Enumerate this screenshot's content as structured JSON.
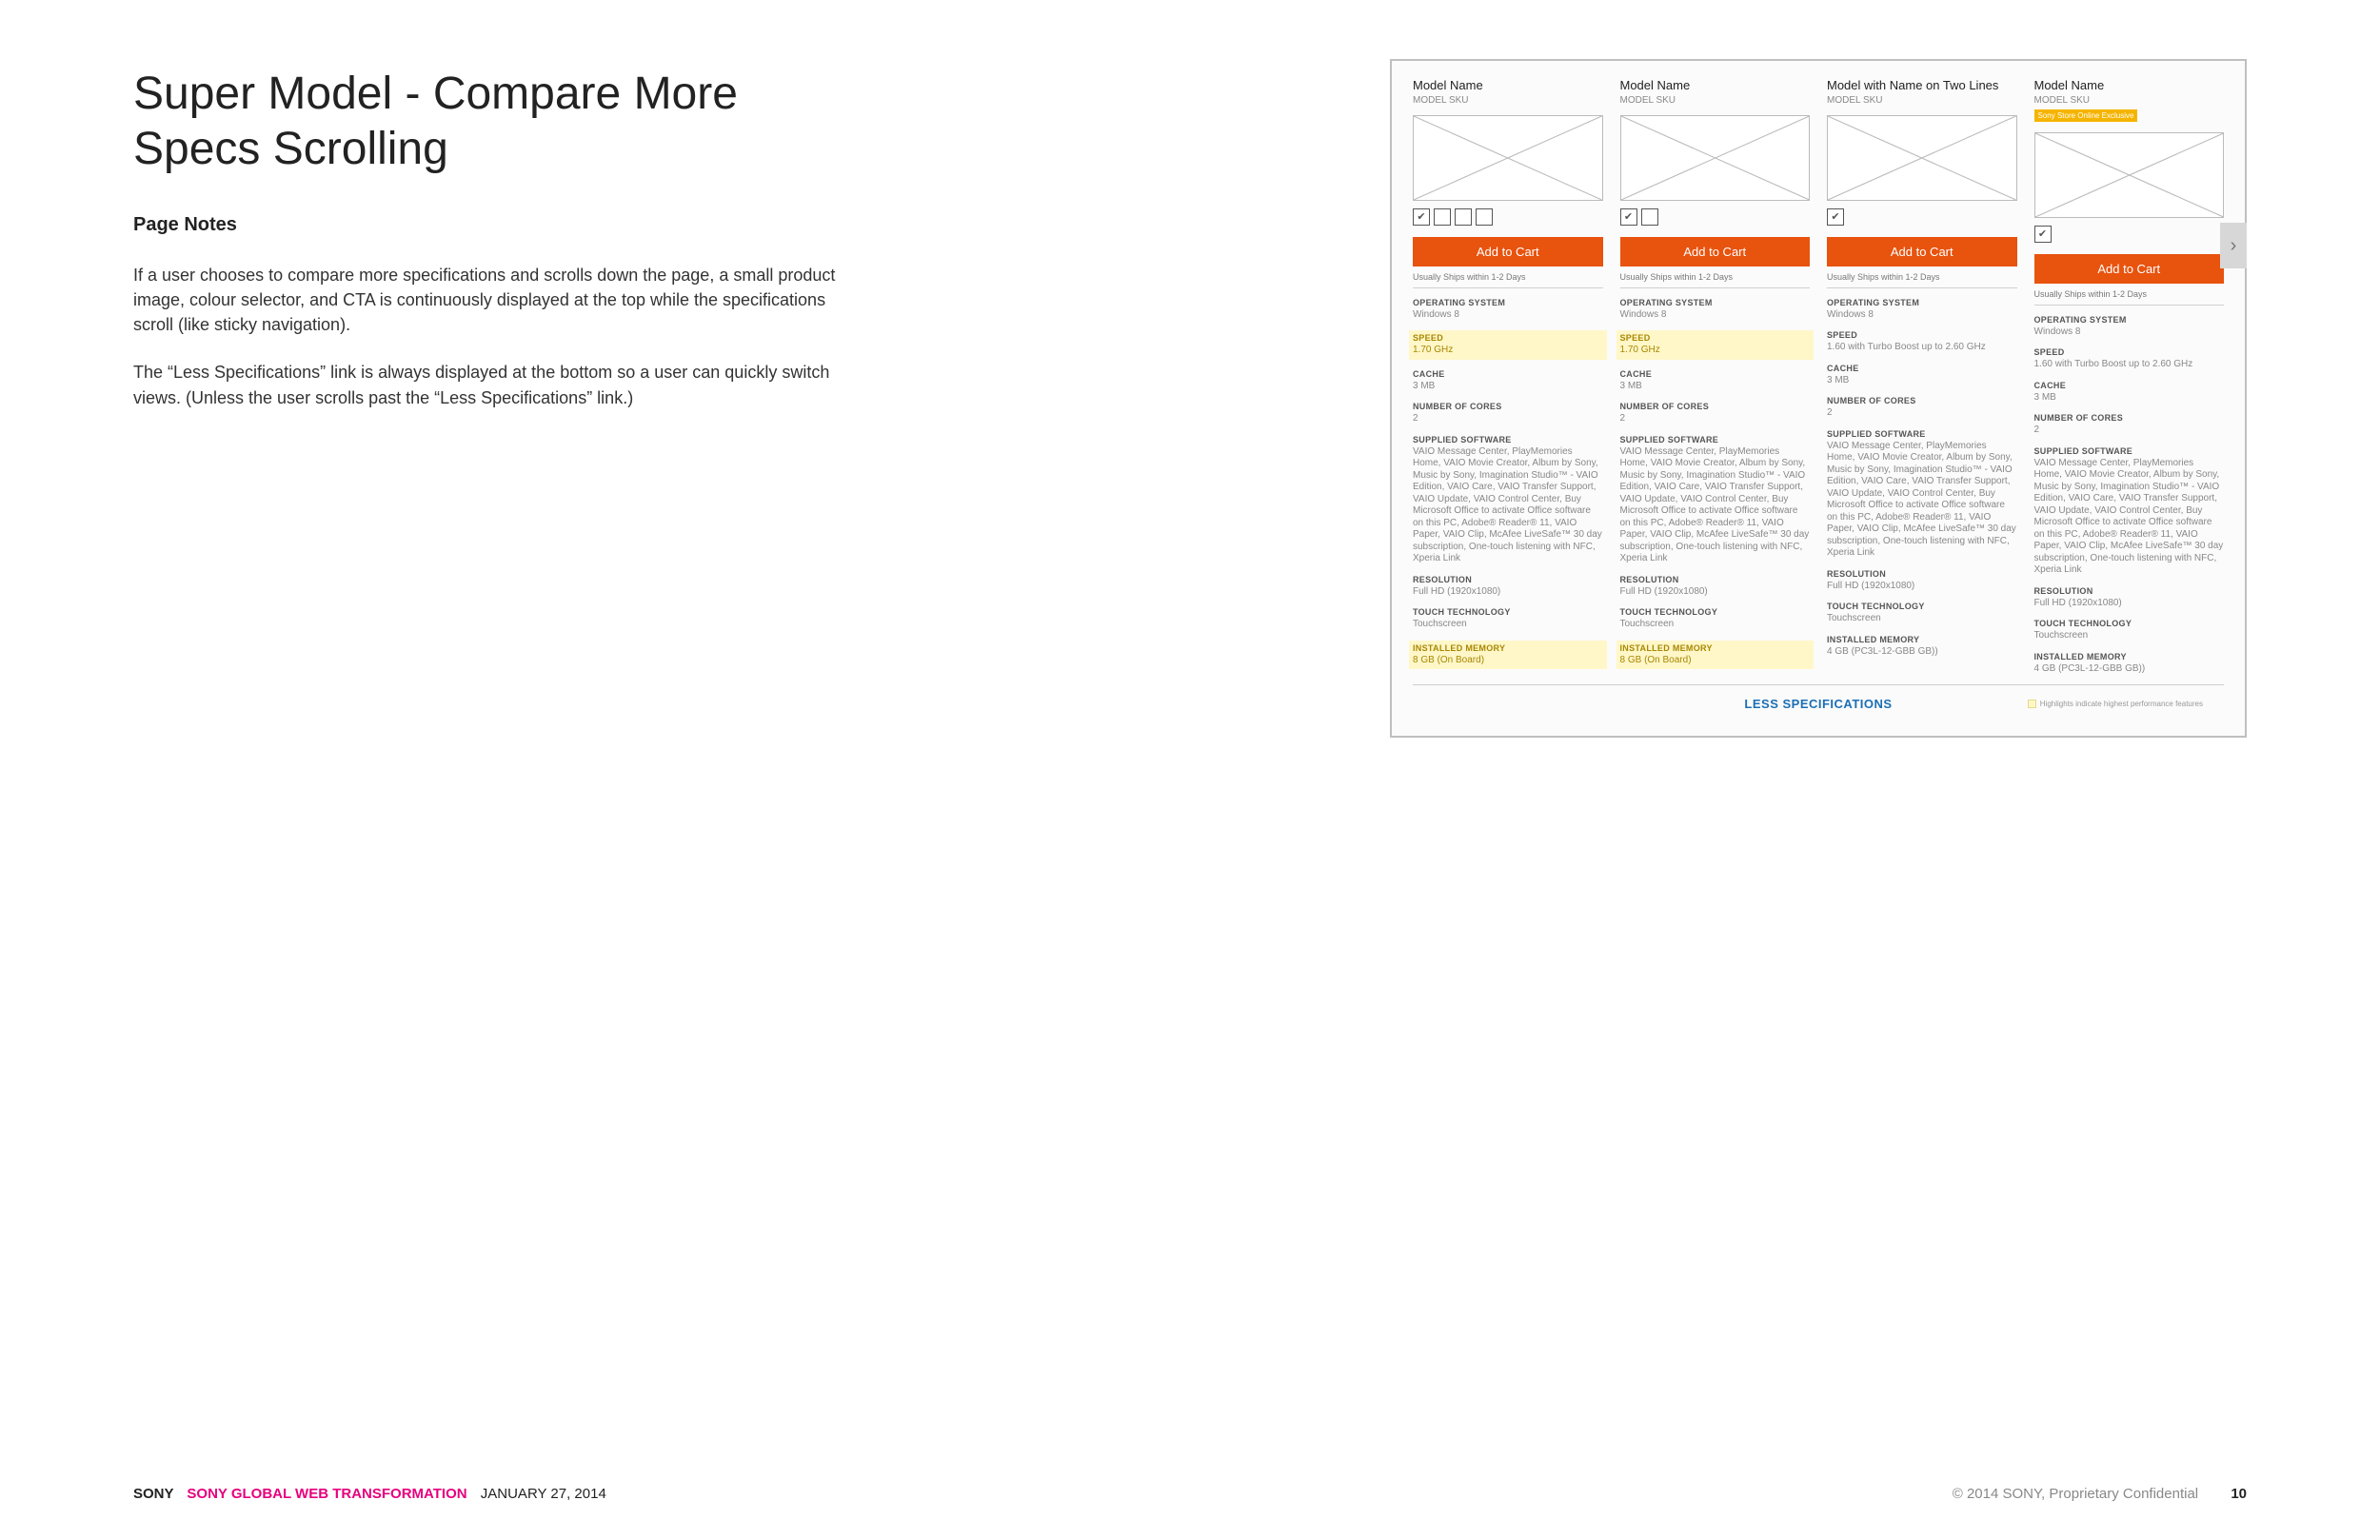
{
  "header": {
    "title": "Super Model - Compare More Specs Scrolling",
    "notes_heading": "Page Notes",
    "para1": "If a user chooses to compare more specifications and scrolls down the page, a small product image, colour selector, and CTA is continuously displayed at the top while the specifications scroll (like sticky navigation).",
    "para2": "The “Less Specifications” link is always displayed at the bottom so a user can quickly switch views. (Unless the user scrolls past the “Less Specifications” link.)"
  },
  "mock": {
    "cta_label": "Add to Cart",
    "ship_text": "Usually Ships within 1-2 Days",
    "less_label": "LESS SPECIFICATIONS",
    "legend_text": "Highlights indicate highest performance features",
    "arrow_glyph": "›",
    "spec_labels": {
      "os": "OPERATING SYSTEM",
      "speed": "SPEED",
      "cache": "CACHE",
      "cores": "NUMBER OF CORES",
      "software": "SUPPLIED SOFTWARE",
      "resolution": "RESOLUTION",
      "touch": "TOUCH TECHNOLOGY",
      "memory": "INSTALLED MEMORY"
    },
    "columns": [
      {
        "name": "Model Name",
        "sku": "MODEL SKU",
        "badge": "",
        "swatch_count": 4,
        "specs": {
          "os": "Windows 8",
          "speed": "1.70 GHz",
          "speed_hl": true,
          "cache": "3 MB",
          "cores": "2",
          "software": "VAIO Message Center, PlayMemories Home, VAIO Movie Creator, Album by Sony, Music by Sony, Imagination Studio™ - VAIO Edition, VAIO Care, VAIO Transfer Support, VAIO Update, VAIO Control Center, Buy Microsoft Office to activate Office software on this PC, Adobe® Reader® 11, VAIO Paper, VAIO Clip, McAfee LiveSafe™ 30 day subscription, One-touch listening with NFC, Xperia Link",
          "resolution": "Full HD (1920x1080)",
          "touch": "Touchscreen",
          "memory": "8 GB (On Board)",
          "memory_hl": true
        }
      },
      {
        "name": "Model Name",
        "sku": "MODEL SKU",
        "badge": "",
        "swatch_count": 2,
        "specs": {
          "os": "Windows 8",
          "speed": "1.70 GHz",
          "speed_hl": true,
          "cache": "3 MB",
          "cores": "2",
          "software": "VAIO Message Center, PlayMemories Home, VAIO Movie Creator, Album by Sony, Music by Sony, Imagination Studio™ - VAIO Edition, VAIO Care, VAIO Transfer Support, VAIO Update, VAIO Control Center, Buy Microsoft Office to activate Office software on this PC, Adobe® Reader® 11, VAIO Paper, VAIO Clip, McAfee LiveSafe™ 30 day subscription, One-touch listening with NFC, Xperia Link",
          "resolution": "Full HD (1920x1080)",
          "touch": "Touchscreen",
          "memory": "8 GB (On Board)",
          "memory_hl": true
        }
      },
      {
        "name": "Model with Name on Two Lines",
        "sku": "MODEL SKU",
        "badge": "",
        "swatch_count": 1,
        "specs": {
          "os": "Windows 8",
          "speed": "1.60 with Turbo Boost up to 2.60 GHz",
          "speed_hl": false,
          "cache": "3 MB",
          "cores": "2",
          "software": "VAIO Message Center, PlayMemories Home, VAIO Movie Creator, Album by Sony, Music by Sony, Imagination Studio™ - VAIO Edition, VAIO Care, VAIO Transfer Support, VAIO Update, VAIO Control Center, Buy Microsoft Office to activate Office software on this PC, Adobe® Reader® 11, VAIO Paper, VAIO Clip, McAfee LiveSafe™ 30 day subscription, One-touch listening with NFC, Xperia Link",
          "resolution": "Full HD (1920x1080)",
          "touch": "Touchscreen",
          "memory": "4 GB (PC3L-12-GBB GB))",
          "memory_hl": false
        }
      },
      {
        "name": "Model Name",
        "sku": "MODEL SKU",
        "badge": "Sony Store Online Exclusive",
        "swatch_count": 1,
        "specs": {
          "os": "Windows 8",
          "speed": "1.60 with Turbo Boost up to 2.60 GHz",
          "speed_hl": false,
          "cache": "3 MB",
          "cores": "2",
          "software": "VAIO Message Center, PlayMemories Home, VAIO Movie Creator, Album by Sony, Music by Sony, Imagination Studio™ - VAIO Edition, VAIO Care, VAIO Transfer Support, VAIO Update, VAIO Control Center, Buy Microsoft Office to activate Office software on this PC, Adobe® Reader® 11, VAIO Paper, VAIO Clip, McAfee LiveSafe™ 30 day subscription, One-touch listening with NFC, Xperia Link",
          "resolution": "Full HD (1920x1080)",
          "touch": "Touchscreen",
          "memory": "4 GB (PC3L-12-GBB GB))",
          "memory_hl": false
        }
      }
    ]
  },
  "footer": {
    "brand": "SONY",
    "project": "SONY GLOBAL WEB TRANSFORMATION",
    "date": "JANUARY 27, 2014",
    "copyright": "© 2014 SONY, Proprietary Confidential",
    "page": "10"
  }
}
